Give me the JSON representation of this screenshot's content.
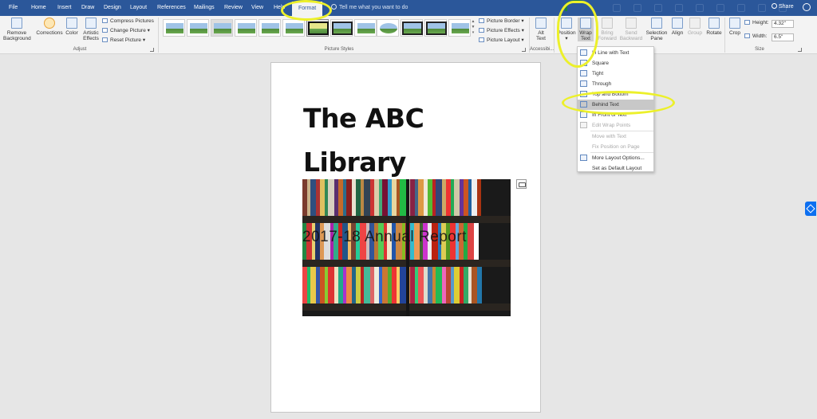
{
  "tabs": [
    "File",
    "Home",
    "Insert",
    "Draw",
    "Design",
    "Layout",
    "References",
    "Mailings",
    "Review",
    "View",
    "Help"
  ],
  "active_tab": "Format",
  "tell_me": "Tell me what you want to do",
  "share": "Share",
  "ribbon": {
    "remove_background": [
      "Remove",
      "Background"
    ],
    "corrections": "Corrections",
    "color": "Color",
    "artistic_effects": [
      "Artistic",
      "Effects"
    ],
    "compress_pictures": "Compress Pictures",
    "change_picture": "Change Picture",
    "reset_picture": "Reset Picture",
    "adjust_label": "Adjust",
    "picture_styles_label": "Picture Styles",
    "picture_border": "Picture Border",
    "picture_effects": "Picture Effects",
    "picture_layout": "Picture Layout",
    "alt_text": [
      "Alt",
      "Text"
    ],
    "accessibility_label": "Accessibi...",
    "position": "Position",
    "wrap_text": [
      "Wrap",
      "Text"
    ],
    "bring_forward": [
      "Bring",
      "Forward"
    ],
    "send_backward": [
      "Send",
      "Backward"
    ],
    "selection_pane": [
      "Selection",
      "Pane"
    ],
    "align": "Align",
    "group": "Group",
    "rotate": "Rotate",
    "crop": "Crop",
    "height_label": "Height:",
    "height_value": "4.32\"",
    "width_label": "Width:",
    "width_value": "6.5\"",
    "size_label": "Size"
  },
  "wrap_menu": [
    {
      "label": "In Line with Text",
      "enabled": true
    },
    {
      "label": "Square",
      "enabled": true
    },
    {
      "label": "Tight",
      "enabled": true
    },
    {
      "label": "Through",
      "enabled": true
    },
    {
      "label": "Top and Bottom",
      "enabled": true
    },
    {
      "label": "Behind Text",
      "enabled": true,
      "hover": true
    },
    {
      "label": "In Front of Text",
      "enabled": true
    },
    {
      "label": "Edit Wrap Points",
      "enabled": false
    },
    {
      "label": "Move with Text",
      "enabled": false
    },
    {
      "label": "Fix Position on Page",
      "enabled": false
    },
    {
      "label": "More Layout Options...",
      "enabled": true
    },
    {
      "label": "Set as Default Layout",
      "enabled": true
    }
  ],
  "document": {
    "title_line1": "The ABC",
    "title_line2": "Library",
    "overlay_text": "2017-18 Annual Report"
  },
  "colors": {
    "ribbon_blue": "#2b579a",
    "highlighter": "#ecf02a",
    "menu_hover": "#c8c8c8"
  }
}
